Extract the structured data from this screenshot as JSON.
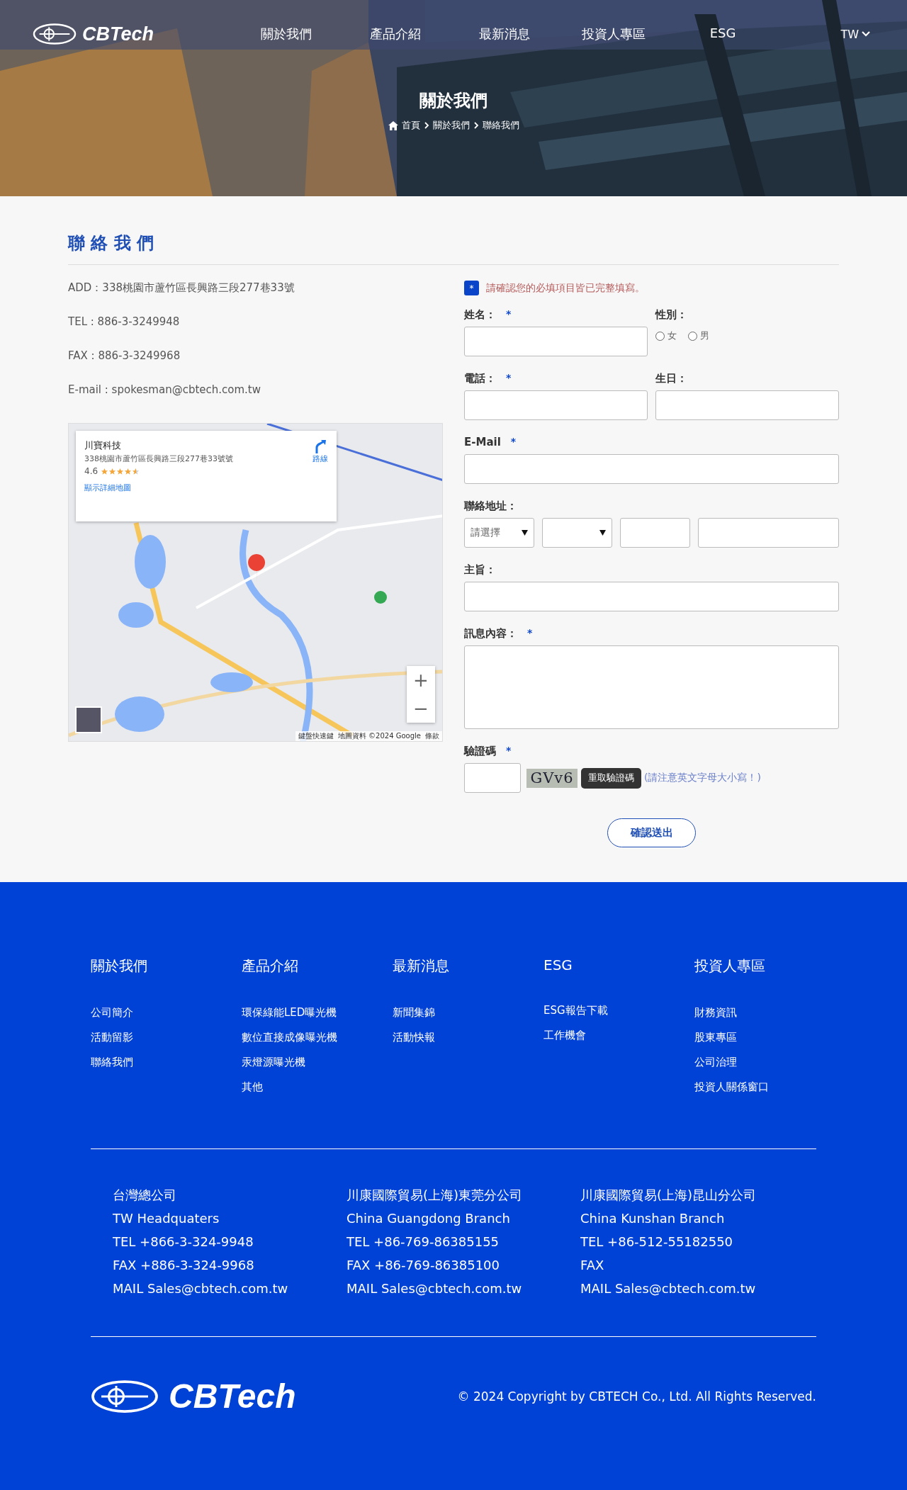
{
  "header": {
    "logo": "CBTech",
    "nav": [
      {
        "label": "關於我們",
        "selected": false
      },
      {
        "label": "產品介紹",
        "selected": false
      },
      {
        "label": "最新消息",
        "selected": false
      },
      {
        "label": "投資人專區",
        "selected": false
      },
      {
        "label": "ESG",
        "selected": false
      }
    ],
    "language": "TW"
  },
  "banner": {
    "kind": "picture",
    "title": "關於我們",
    "breadcrumb": [
      "首頁",
      "關於我們",
      "聯絡我們"
    ]
  },
  "contact": {
    "title": "聯 絡 我 們",
    "lines": [
      "ADD：338桃園市蘆竹區長興路三段277巷33號",
      "TEL : 886-3-3249948",
      "FAX : 886-3-3249968",
      "E-mail : spokesman@cbtech.com.tw"
    ],
    "map": {
      "kind": "picture",
      "place_name": "川寶科技",
      "address": "338桃園市蘆竹區長興路三段277巷33號號",
      "rating": "4.6",
      "stars": 4.5,
      "directions": "路線",
      "detail_link": "顯示詳細地圖",
      "zoom_in": "+",
      "zoom_out": "−",
      "attribution": [
        "鍵盤快速鍵",
        "地圖資料 ©2024 Google",
        "條款"
      ]
    }
  },
  "form": {
    "notice_mark": "*",
    "notice": "請確認您的必填項目皆已完整填寫。",
    "name": {
      "label": "姓名：",
      "required": true
    },
    "gender": {
      "label": "性別：",
      "options": [
        {
          "label": "女",
          "selected": false
        },
        {
          "label": "男",
          "selected": false
        }
      ]
    },
    "phone": {
      "label": "電話：",
      "required": true
    },
    "birthday": {
      "label": "生日："
    },
    "email": {
      "label": "E-Mail",
      "required": true
    },
    "address": {
      "label": "聯絡地址：",
      "city_select": "請選擇"
    },
    "subject": {
      "label": "主旨："
    },
    "message": {
      "label": "訊息內容：",
      "required": true
    },
    "captcha": {
      "label": "驗證碼",
      "required": true,
      "code": "GVv6",
      "refresh": "重取驗證碼",
      "hint": "(請注意英文字母大小寫！)"
    },
    "submit": "確認送出"
  },
  "footer": {
    "columns": [
      {
        "title": "關於我們",
        "links": [
          "公司簡介",
          "活動留影",
          "聯絡我們"
        ]
      },
      {
        "title": "產品介紹",
        "links": [
          "環保綠能LED曝光機",
          "數位直接成像曝光機",
          "汞燈源曝光機",
          "其他"
        ]
      },
      {
        "title": "最新消息",
        "links": [
          "新聞集錦",
          "活動快報"
        ]
      },
      {
        "title": "ESG",
        "links": [
          "ESG報告下載",
          "工作機會"
        ]
      },
      {
        "title": "投資人專區",
        "links": [
          "財務資訊",
          "股東專區",
          "公司治理",
          "投資人關係窗口"
        ]
      }
    ],
    "offices": [
      {
        "lines": [
          "台灣總公司",
          "TW Headquaters",
          "TEL +866-3-324-9948",
          "FAX +886-3-324-9968",
          "MAIL Sales@cbtech.com.tw"
        ]
      },
      {
        "lines": [
          "川康國際貿易(上海)東莞分公司",
          "China Guangdong Branch",
          "TEL +86-769-86385155",
          "FAX +86-769-86385100",
          "MAIL Sales@cbtech.com.tw"
        ]
      },
      {
        "lines": [
          "川康國際貿易(上海)昆山分公司",
          "China Kunshan Branch",
          "TEL +86-512-55182550",
          "FAX",
          "MAIL Sales@cbtech.com.tw"
        ]
      }
    ],
    "logo": "CBTech",
    "copyright": "© 2024 Copyright by CBTECH Co., Ltd. All Rights Reserved."
  }
}
